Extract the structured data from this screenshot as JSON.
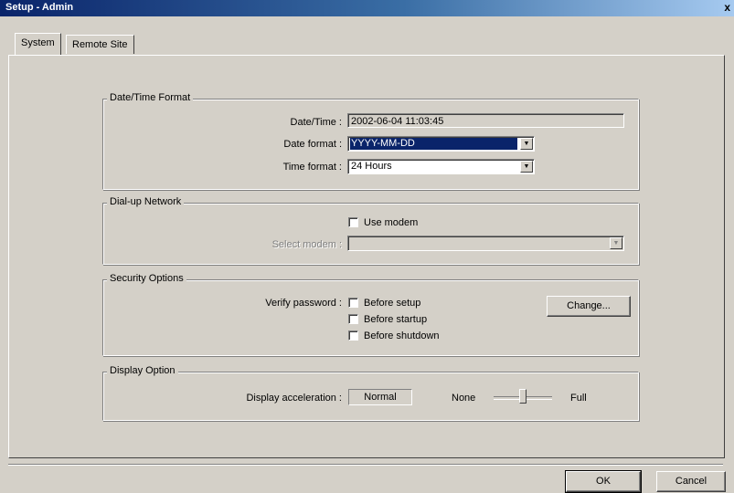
{
  "window": {
    "title": "Setup - Admin",
    "close_glyph": "x"
  },
  "tabs": [
    {
      "label": "System",
      "active": true
    },
    {
      "label": "Remote Site",
      "active": false
    }
  ],
  "datetime": {
    "legend": "Date/Time Format",
    "datetime_label": "Date/Time :",
    "datetime_value": "2002-06-04 11:03:45",
    "date_format_label": "Date format :",
    "date_format_value": "YYYY-MM-DD",
    "time_format_label": "Time format :",
    "time_format_value": "24 Hours"
  },
  "dialup": {
    "legend": "Dial-up Network",
    "use_modem_label": "Use modem",
    "use_modem_checked": false,
    "select_modem_label": "Select modem :",
    "select_modem_value": ""
  },
  "security": {
    "legend": "Security Options",
    "verify_label": "Verify password :",
    "before_setup": "Before setup",
    "before_startup": "Before startup",
    "before_shutdown": "Before shutdown",
    "change_button": "Change..."
  },
  "display": {
    "legend": "Display Option",
    "accel_label": "Display acceleration :",
    "accel_value": "Normal",
    "min_label": "None",
    "max_label": "Full",
    "slider_level": 0.5
  },
  "footer": {
    "ok_label": "OK",
    "cancel_label": "Cancel"
  },
  "colors": {
    "face": "#d4d0c8",
    "title_start": "#0a246a",
    "selection": "#0a246a"
  }
}
